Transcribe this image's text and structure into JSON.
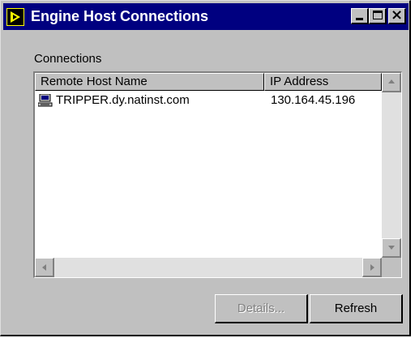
{
  "window": {
    "title": "Engine Host Connections",
    "controls": [
      "minimize-icon",
      "maximize-icon",
      "close-icon"
    ]
  },
  "connections": {
    "label": "Connections",
    "columns": [
      "Remote Host Name",
      "IP Address"
    ],
    "rows": [
      {
        "icon": "computer-icon",
        "host": "TRIPPER.dy.natinst.com",
        "ip": "130.164.45.196"
      }
    ]
  },
  "buttons": {
    "details_label": "Details...",
    "details_enabled": false,
    "refresh_label": "Refresh"
  },
  "colors": {
    "titlebar": "#000080",
    "face": "#c0c0c0",
    "disabled_text": "#808080"
  }
}
